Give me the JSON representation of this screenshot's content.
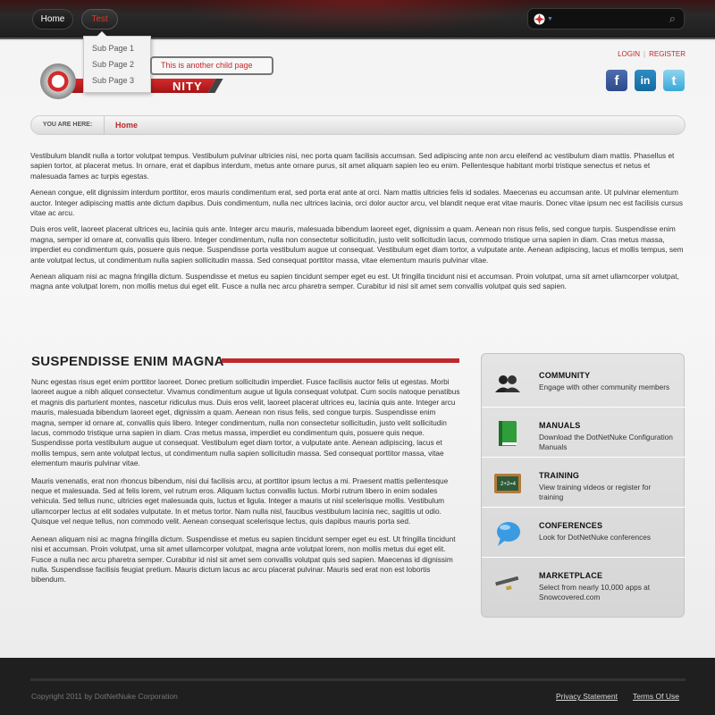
{
  "nav": {
    "home_label": "Home",
    "test_label": "Test"
  },
  "dropdown": {
    "items": [
      "Sub Page 1",
      "Sub Page 2",
      "Sub Page 3"
    ],
    "child_popup": "This is another child page"
  },
  "header": {
    "logo_text": "NITY",
    "login": "LOGIN",
    "register": "REGISTER"
  },
  "breadcrumb": {
    "label": "YOU ARE HERE:",
    "current": "Home"
  },
  "intro_paragraphs": [
    " Vestibulum blandit nulla a tortor volutpat tempus. Vestibulum pulvinar ultricies nisi, nec porta quam facilisis accumsan. Sed adipiscing ante non arcu eleifend ac vestibulum diam mattis. Phasellus et sapien tortor, at placerat metus. In ornare, erat et dapibus interdum, metus ante ornare purus, sit amet aliquam sapien leo eu enim. Pellentesque habitant morbi tristique senectus et netus et malesuada fames ac turpis egestas.",
    "Aenean congue, elit dignissim interdum porttitor, eros mauris condimentum erat, sed porta erat ante at orci. Nam mattis ultricies felis id sodales. Maecenas eu accumsan ante. Ut pulvinar elementum auctor. Integer adipiscing mattis ante dictum dapibus. Duis condimentum, nulla nec ultrices lacinia, orci dolor auctor arcu, vel blandit neque erat vitae mauris. Donec vitae ipsum nec est facilisis cursus vitae ac arcu.",
    "Duis eros velit, laoreet placerat ultrices eu, lacinia quis ante. Integer arcu mauris, malesuada bibendum laoreet eget, dignissim a quam. Aenean non risus felis, sed congue turpis. Suspendisse enim magna, semper id ornare at, convallis quis libero. Integer condimentum, nulla non consectetur sollicitudin, justo velit sollicitudin lacus, commodo tristique urna sapien in diam. Cras metus massa, imperdiet eu condimentum quis, posuere quis neque. Suspendisse porta vestibulum augue ut consequat. Vestibulum eget diam tortor, a vulputate ante. Aenean adipiscing, lacus et mollis tempus, sem ante volutpat lectus, ut condimentum nulla sapien sollicitudin massa. Sed consequat porttitor massa, vitae elementum mauris pulvinar vitae.",
    "Aenean aliquam nisi ac magna fringilla dictum. Suspendisse et metus eu sapien tincidunt semper eget eu est. Ut fringilla tincidunt nisi et accumsan. Proin volutpat, urna sit amet ullamcorper volutpat, magna ante volutpat lorem, non mollis metus dui eget elit. Fusce a nulla nec arcu pharetra semper. Curabitur id nisl sit amet sem convallis volutpat quis sed sapien."
  ],
  "section": {
    "title": "SUSPENDISSE ENIM MAGNA",
    "paragraphs": [
      "Nunc egestas risus eget enim porttitor laoreet. Donec pretium sollicitudin imperdiet. Fusce facilisis auctor felis ut egestas. Morbi laoreet augue a nibh aliquet consectetur. Vivamus condimentum augue ut ligula consequat volutpat. Cum sociis natoque penatibus et magnis dis parturient montes, nascetur ridiculus mus. Duis eros velit, laoreet placerat ultrices eu, lacinia quis ante. Integer arcu mauris, malesuada bibendum laoreet eget, dignissim a quam. Aenean non risus felis, sed congue turpis. Suspendisse enim magna, semper id ornare at, convallis quis libero. Integer condimentum, nulla non consectetur sollicitudin, justo velit sollicitudin lacus, commodo tristique urna sapien in diam. Cras metus massa, imperdiet eu condimentum quis, posuere quis neque. Suspendisse porta vestibulum augue ut consequat. Vestibulum eget diam tortor, a vulputate ante. Aenean adipiscing, lacus et mollis tempus, sem ante volutpat lectus, ut condimentum nulla sapien sollicitudin massa. Sed consequat porttitor massa, vitae elementum mauris pulvinar vitae.",
      "Mauris venenatis, erat non rhoncus bibendum, nisi dui facilisis arcu, at porttitor ipsum lectus a mi. Praesent mattis pellentesque neque et malesuada. Sed at felis lorem, vel rutrum eros. Aliquam luctus convallis luctus. Morbi rutrum libero in enim sodales vehicula. Sed tellus nunc, ultricies eget malesuada quis, luctus et ligula. Integer a mauris ut nisl scelerisque mollis. Vestibulum ullamcorper lectus at elit sodales vulputate. In et metus tortor. Nam nulla nisl, faucibus vestibulum lacinia nec, sagittis ut odio. Quisque vel neque tellus, non commodo velit. Aenean consequat scelerisque lectus, quis dapibus mauris porta sed.",
      "Aenean aliquam nisi ac magna fringilla dictum. Suspendisse et metus eu sapien tincidunt semper eget eu est. Ut fringilla tincidunt nisi et accumsan. Proin volutpat, urna sit amet ullamcorper volutpat, magna ante volutpat lorem, non mollis metus dui eget elit. Fusce a nulla nec arcu pharetra semper. Curabitur id nisl sit amet sem convallis volutpat quis sed sapien. Maecenas id dignissim nulla. Suspendisse facilisis feugiat pretium. Mauris dictum lacus ac arcu placerat pulvinar. Mauris sed erat non est lobortis bibendum."
    ]
  },
  "sidebar": {
    "items": [
      {
        "title": "COMMUNITY",
        "desc": "Engage with other community members",
        "icon": "community-icon"
      },
      {
        "title": "MANUALS",
        "desc": "Download the DotNetNuke Configuration Manuals",
        "icon": "book-icon"
      },
      {
        "title": "TRAINING",
        "desc": "View training videos or register for training",
        "icon": "chalkboard-icon"
      },
      {
        "title": "CONFERENCES",
        "desc": "Look for DotNetNuke conferences",
        "icon": "speech-bubble-icon"
      },
      {
        "title": "MARKETPLACE",
        "desc": "Select from nearly 10,000 apps at Snowcovered.com",
        "icon": "credit-card-icon"
      }
    ]
  },
  "footer": {
    "copyright": "Copyright 2011 by DotNetNuke Corporation",
    "privacy": "Privacy Statement",
    "terms": "Terms Of Use"
  },
  "colors": {
    "accent": "#c0282b",
    "topbar": "#1e1e1e",
    "footer": "#1f1f1f"
  }
}
